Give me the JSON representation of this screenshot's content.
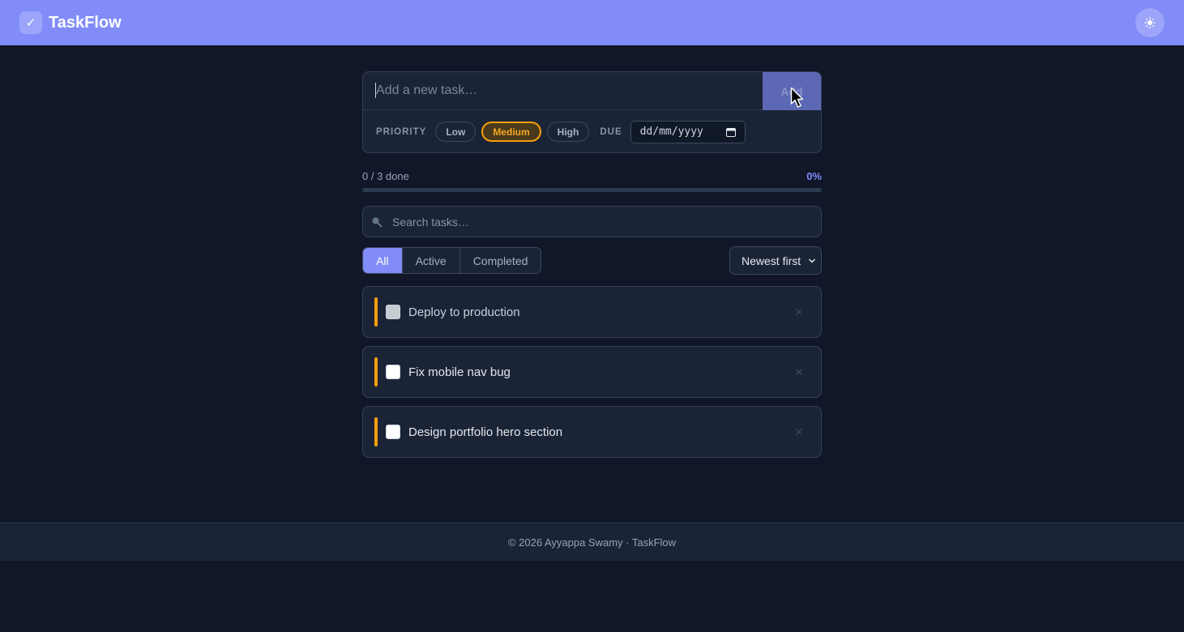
{
  "app": {
    "title": "TaskFlow",
    "logo_icon": "check-icon",
    "theme_icon": "sun-icon"
  },
  "composer": {
    "placeholder": "Add a new task…",
    "value": "",
    "add_label": "Add",
    "priority_label": "PRIORITY",
    "priorities": [
      "Low",
      "Medium",
      "High"
    ],
    "selected_priority": "Medium",
    "due_label": "DUE",
    "due_placeholder": "dd/mm/yyyy"
  },
  "progress": {
    "count_text": "0 / 3 done",
    "percent_text": "0%",
    "fraction": 0
  },
  "search": {
    "placeholder": "Search tasks…"
  },
  "filters": {
    "tabs": [
      "All",
      "Active",
      "Completed"
    ],
    "active": "All"
  },
  "sort": {
    "selected": "Newest first"
  },
  "tasks": [
    {
      "text": "Deploy to production",
      "priority": "Medium",
      "done": false
    },
    {
      "text": "Fix mobile nav bug",
      "priority": "Medium",
      "done": false
    },
    {
      "text": "Design portfolio hero section",
      "priority": "Medium",
      "done": false
    }
  ],
  "footer": {
    "text": "© 2026 Ayyappa Swamy · TaskFlow"
  },
  "colors": {
    "accent": "#818cf8",
    "priority_medium": "#f59e0b",
    "background": "#111729",
    "card": "#1b2436"
  }
}
